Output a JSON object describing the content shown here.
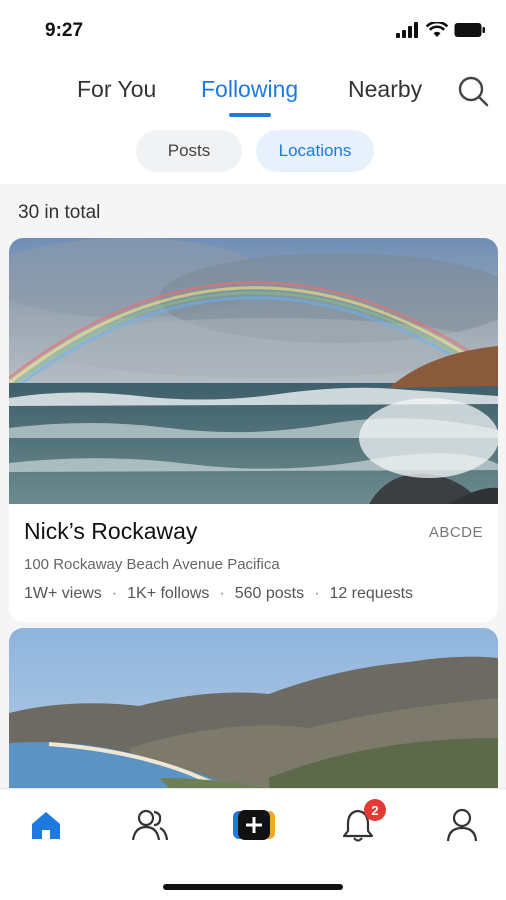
{
  "status_bar": {
    "time": "9:27"
  },
  "top_tabs": [
    {
      "label": "For You"
    },
    {
      "label": "Following",
      "active": true
    },
    {
      "label": "Nearby"
    }
  ],
  "segments": [
    {
      "label": "Posts"
    },
    {
      "label": "Locations",
      "active": true
    }
  ],
  "summary": {
    "total_text": "30 in total"
  },
  "cards": [
    {
      "title": "Nick’s Rockaway",
      "tag": "ABCDE",
      "address": "100 Rockaway Beach Avenue Pacifica",
      "stats": [
        "1W+ views",
        "1K+ follows",
        "560 posts",
        "12 requests"
      ]
    }
  ],
  "bottom_nav": {
    "items": [
      "home-icon",
      "friends-icon",
      "add-post-icon",
      "notification-bell-icon",
      "profile-icon"
    ],
    "notification_badge": "2"
  },
  "colors": {
    "accent": "#1f7ae0",
    "badge": "#e53935"
  }
}
